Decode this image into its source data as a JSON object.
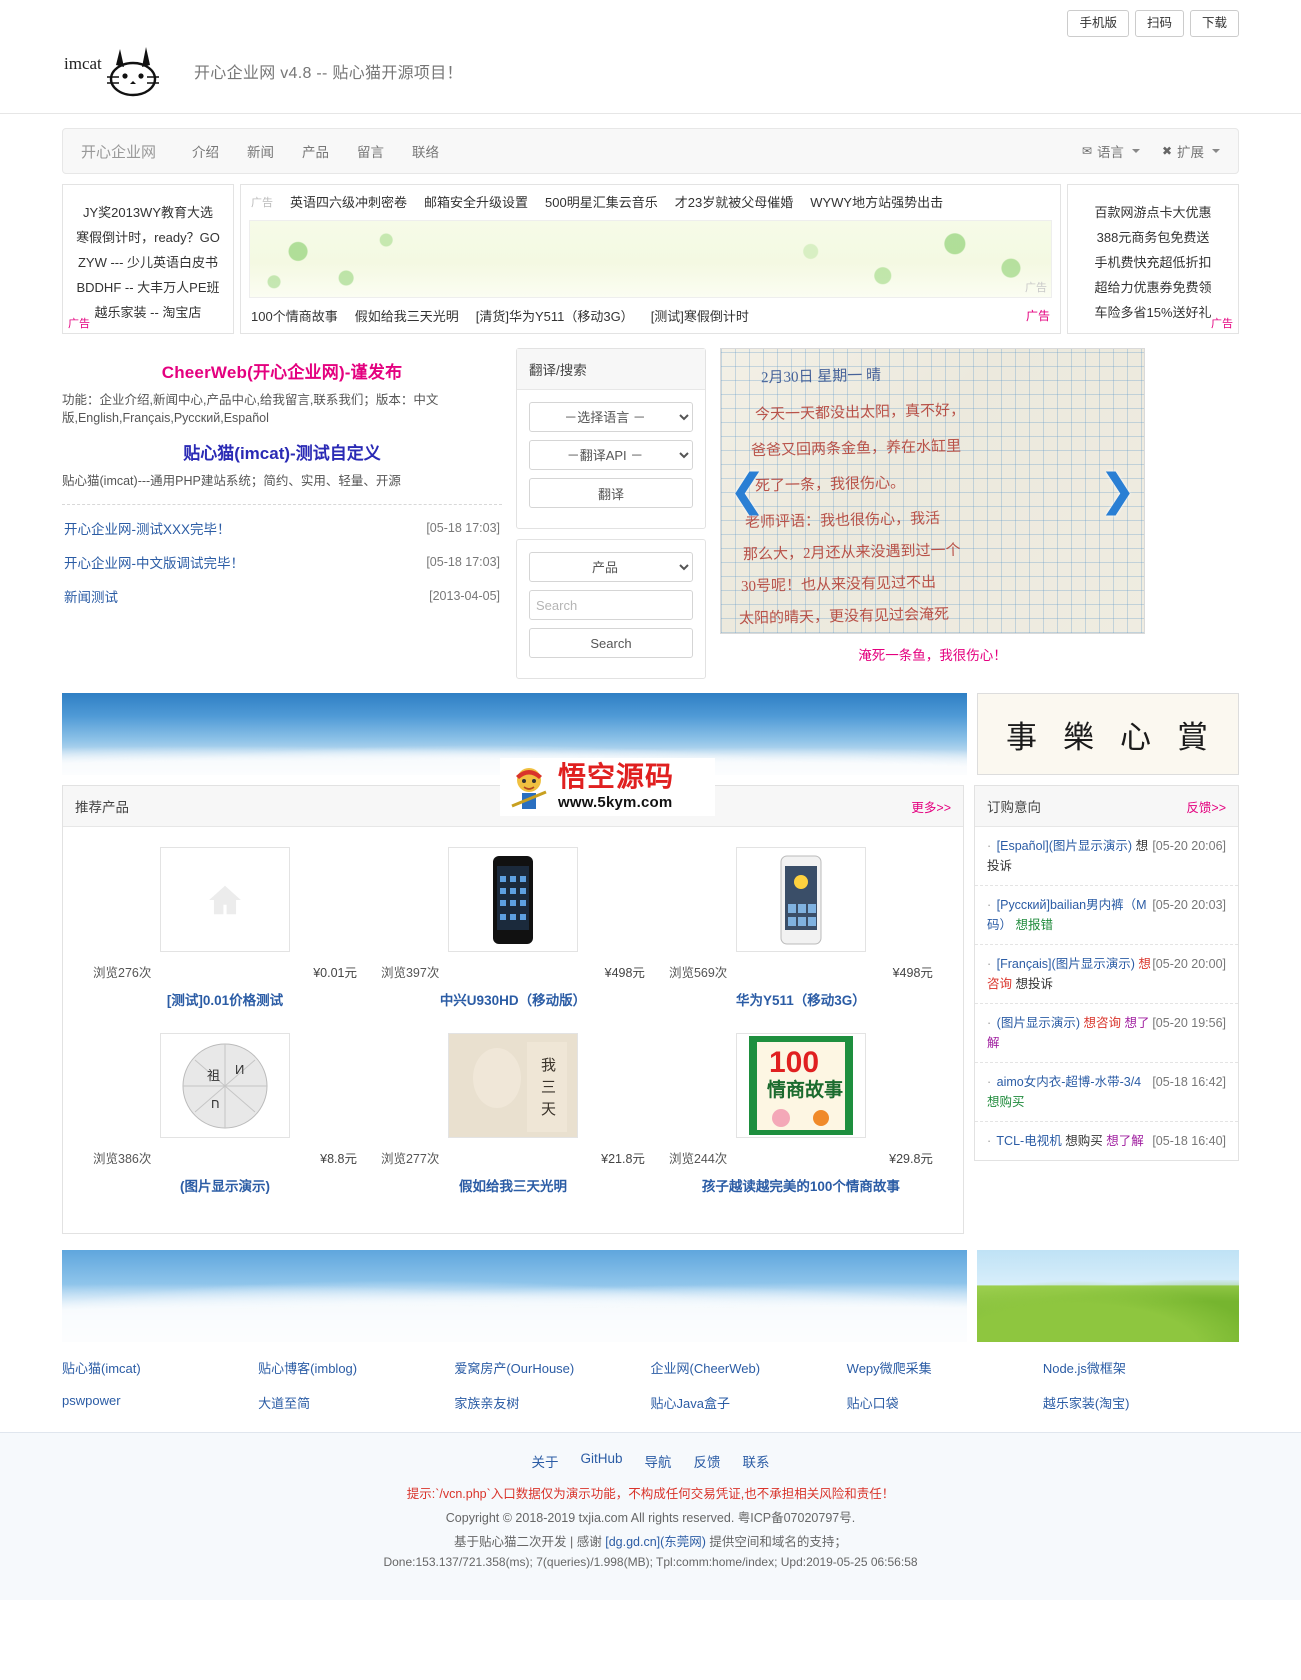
{
  "topbar": {
    "buttons": [
      "手机版",
      "扫码",
      "下载"
    ]
  },
  "header": {
    "logo_text": "imcat",
    "site_title": "开心企业网 v4.8 -- 贴心猫开源项目！"
  },
  "nav": {
    "brand": "开心企业网",
    "items": [
      "介绍",
      "新闻",
      "产品",
      "留言",
      "联络"
    ],
    "right": [
      {
        "icon": "globe-icon",
        "glyph": "✉",
        "label": "语言"
      },
      {
        "icon": "puzzle-icon",
        "glyph": "✖",
        "label": "扩展"
      }
    ]
  },
  "ads": {
    "left": {
      "links": [
        "JY奖2013WY教育大选",
        "寒假倒计时，ready？GO",
        "ZYW --- 少儿英语白皮书",
        "BDDHF -- 大丰万人PE班",
        "越乐家装 -- 淘宝店"
      ],
      "tag": "广告"
    },
    "center": {
      "tag": "广告",
      "top_links": [
        "英语四六级冲刺密卷",
        "邮箱安全升级设置",
        "500明星汇集云音乐",
        "才23岁就被父母催婚",
        "WYWY地方站强势出击"
      ],
      "banner_tag": "广告",
      "bottom_links": [
        "100个情商故事",
        "假如给我三天光明",
        "[清货]华为Y511（移动3G）",
        "[测试]寒假倒计时"
      ],
      "bottom_tag": "广告"
    },
    "right": {
      "links": [
        "百款网游点卡大优惠",
        "388元商务包免费送",
        "手机费快充超低折扣",
        "超给力优惠券免费领",
        "车险多省15%送好礼"
      ],
      "tag": "广告"
    }
  },
  "promo": {
    "title": "CheerWeb(开心企业网)-谨发布",
    "desc": "功能：企业介绍,新闻中心,产品中心,给我留言,联系我们；版本：中文版,English,Français,Русский,Español",
    "title2": "贴心猫(imcat)-测试自定义",
    "desc2": "贴心猫(imcat)---通用PHP建站系统；简约、实用、轻量、开源"
  },
  "news": [
    {
      "title": "开心企业网-测试XXX完毕！",
      "date": "[05-18 17:03]"
    },
    {
      "title": "开心企业网-中文版调试完毕！",
      "date": "[05-18 17:03]"
    },
    {
      "title": "新闻测试",
      "date": "[2013-04-05]"
    }
  ],
  "translate_panel": {
    "title": "翻译/搜索",
    "language_select": "－选择语言 －",
    "api_select": "－翻译API －",
    "translate_button": "翻译",
    "category_select": "产品",
    "search_placeholder": "Search",
    "search_button": "Search"
  },
  "slideshow": {
    "caption": "淹死一条鱼，我很伤心！",
    "prev": "❮",
    "next": "❯",
    "hand_lines": [
      "2月30日   星期一   晴",
      "今天一天都没出太阳，真不好，",
      "爸爸又回两条金鱼，养在水缸里",
      "死了一条，我很伤心。",
      "老师评语：我也很伤心，我活",
      "那么大，2月还从来没遇到过一个",
      "30号呢！也从来没有见过不出",
      "太阳的晴天，更没有见过会淹死"
    ]
  },
  "calligraphy": [
    "事",
    "樂",
    "心",
    "賞"
  ],
  "products_panel": {
    "title": "推荐产品",
    "more": "更多>>",
    "items": [
      {
        "views": "浏览276次",
        "price": "¥0.01元",
        "name": "[测试]0.01价格测试",
        "thumb": "home-placeholder"
      },
      {
        "views": "浏览397次",
        "price": "¥498元",
        "name": "中兴U930HD（移动版）",
        "thumb": "phone-black"
      },
      {
        "views": "浏览569次",
        "price": "¥498元",
        "name": "华为Y511（移动3G）",
        "thumb": "phone-white"
      },
      {
        "views": "浏览386次",
        "price": "¥8.8元",
        "name": "(图片显示演示)",
        "thumb": "wiki-globe"
      },
      {
        "views": "浏览277次",
        "price": "¥21.8元",
        "name": "假如给我三天光明",
        "thumb": "book-beige"
      },
      {
        "views": "浏览244次",
        "price": "¥29.8元",
        "name": "孩子越读越完美的100个情商故事",
        "thumb": "book-100"
      }
    ]
  },
  "orders_panel": {
    "title": "订购意向",
    "more": "反馈>>",
    "items": [
      {
        "name": "[Español](图片显示演示)",
        "time": "[05-20 20:06]",
        "tags": [
          {
            "text": "想投诉",
            "color": "dark"
          }
        ]
      },
      {
        "name": "[Русский]bailian男内裤（M码）",
        "time": "[05-20 20:03]",
        "tags": [
          {
            "text": "想报错",
            "color": "green"
          }
        ]
      },
      {
        "name": "[Français](图片显示演示)",
        "time": "[05-20 20:00]",
        "tags": [
          {
            "text": "想咨询",
            "color": "red"
          },
          {
            "text": "想投诉",
            "color": "dark"
          }
        ]
      },
      {
        "name": "(图片显示演示)",
        "time": "[05-20 19:56]",
        "tags": [
          {
            "text": "想咨询",
            "color": "red"
          },
          {
            "text": "想了解",
            "color": "purple"
          }
        ]
      },
      {
        "name": "aimo女内衣-超博-水带-3/4",
        "time": "[05-18 16:42]",
        "tags": [
          {
            "text": "想购买",
            "color": "green"
          }
        ]
      },
      {
        "name": "TCL-电视机",
        "time": "[05-18 16:40]",
        "tags": [
          {
            "text": "想购买",
            "color": "dark"
          },
          {
            "text": "想了解",
            "color": "purple"
          }
        ]
      }
    ]
  },
  "watermark": {
    "cn": "悟空源码",
    "url": "www.5kym.com"
  },
  "partner_links": [
    "贴心猫(imcat)",
    "贴心博客(imblog)",
    "爱窝房产(OurHouse)",
    "企业网(CheerWeb)",
    "Wepy微爬采集",
    "Node.js微框架",
    "pswpower",
    "大道至简",
    "家族亲友树",
    "贴心Java盒子",
    "贴心口袋",
    "越乐家装(淘宝)"
  ],
  "footer": {
    "nav": [
      "关于",
      "GitHub",
      "导航",
      "反馈",
      "联系"
    ],
    "warn": "提示:`/vcn.php`入口数据仅为演示功能，不构成任何交易凭证,也不承担相关风险和责任！",
    "copyright": "Copyright © 2018-2019 txjia.com All rights reserved. 粤ICP备07020797号.",
    "credit_pre": "基于贴心猫二次开发 | 感谢 ",
    "credit_link": "[dg.gd.cn](东莞网)",
    "credit_post": " 提供空间和域名的支持；",
    "stats": "Done:153.137/721.358(ms); 7(queries)/1.998(MB); Tpl:comm:home/index; Upd:2019-05-25 06:56:58"
  }
}
